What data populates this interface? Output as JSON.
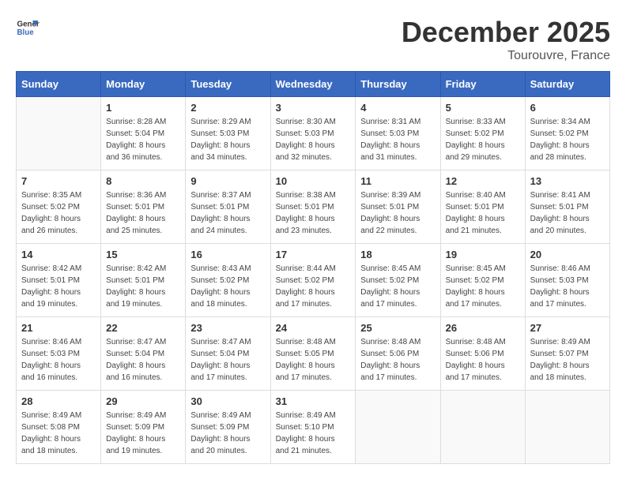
{
  "header": {
    "logo_line1": "General",
    "logo_line2": "Blue",
    "month": "December 2025",
    "location": "Tourouvre, France"
  },
  "days_of_week": [
    "Sunday",
    "Monday",
    "Tuesday",
    "Wednesday",
    "Thursday",
    "Friday",
    "Saturday"
  ],
  "weeks": [
    [
      {
        "day": "",
        "info": ""
      },
      {
        "day": "1",
        "info": "Sunrise: 8:28 AM\nSunset: 5:04 PM\nDaylight: 8 hours\nand 36 minutes."
      },
      {
        "day": "2",
        "info": "Sunrise: 8:29 AM\nSunset: 5:03 PM\nDaylight: 8 hours\nand 34 minutes."
      },
      {
        "day": "3",
        "info": "Sunrise: 8:30 AM\nSunset: 5:03 PM\nDaylight: 8 hours\nand 32 minutes."
      },
      {
        "day": "4",
        "info": "Sunrise: 8:31 AM\nSunset: 5:03 PM\nDaylight: 8 hours\nand 31 minutes."
      },
      {
        "day": "5",
        "info": "Sunrise: 8:33 AM\nSunset: 5:02 PM\nDaylight: 8 hours\nand 29 minutes."
      },
      {
        "day": "6",
        "info": "Sunrise: 8:34 AM\nSunset: 5:02 PM\nDaylight: 8 hours\nand 28 minutes."
      }
    ],
    [
      {
        "day": "7",
        "info": "Sunrise: 8:35 AM\nSunset: 5:02 PM\nDaylight: 8 hours\nand 26 minutes."
      },
      {
        "day": "8",
        "info": "Sunrise: 8:36 AM\nSunset: 5:01 PM\nDaylight: 8 hours\nand 25 minutes."
      },
      {
        "day": "9",
        "info": "Sunrise: 8:37 AM\nSunset: 5:01 PM\nDaylight: 8 hours\nand 24 minutes."
      },
      {
        "day": "10",
        "info": "Sunrise: 8:38 AM\nSunset: 5:01 PM\nDaylight: 8 hours\nand 23 minutes."
      },
      {
        "day": "11",
        "info": "Sunrise: 8:39 AM\nSunset: 5:01 PM\nDaylight: 8 hours\nand 22 minutes."
      },
      {
        "day": "12",
        "info": "Sunrise: 8:40 AM\nSunset: 5:01 PM\nDaylight: 8 hours\nand 21 minutes."
      },
      {
        "day": "13",
        "info": "Sunrise: 8:41 AM\nSunset: 5:01 PM\nDaylight: 8 hours\nand 20 minutes."
      }
    ],
    [
      {
        "day": "14",
        "info": "Sunrise: 8:42 AM\nSunset: 5:01 PM\nDaylight: 8 hours\nand 19 minutes."
      },
      {
        "day": "15",
        "info": "Sunrise: 8:42 AM\nSunset: 5:01 PM\nDaylight: 8 hours\nand 19 minutes."
      },
      {
        "day": "16",
        "info": "Sunrise: 8:43 AM\nSunset: 5:02 PM\nDaylight: 8 hours\nand 18 minutes."
      },
      {
        "day": "17",
        "info": "Sunrise: 8:44 AM\nSunset: 5:02 PM\nDaylight: 8 hours\nand 17 minutes."
      },
      {
        "day": "18",
        "info": "Sunrise: 8:45 AM\nSunset: 5:02 PM\nDaylight: 8 hours\nand 17 minutes."
      },
      {
        "day": "19",
        "info": "Sunrise: 8:45 AM\nSunset: 5:02 PM\nDaylight: 8 hours\nand 17 minutes."
      },
      {
        "day": "20",
        "info": "Sunrise: 8:46 AM\nSunset: 5:03 PM\nDaylight: 8 hours\nand 17 minutes."
      }
    ],
    [
      {
        "day": "21",
        "info": "Sunrise: 8:46 AM\nSunset: 5:03 PM\nDaylight: 8 hours\nand 16 minutes."
      },
      {
        "day": "22",
        "info": "Sunrise: 8:47 AM\nSunset: 5:04 PM\nDaylight: 8 hours\nand 16 minutes."
      },
      {
        "day": "23",
        "info": "Sunrise: 8:47 AM\nSunset: 5:04 PM\nDaylight: 8 hours\nand 17 minutes."
      },
      {
        "day": "24",
        "info": "Sunrise: 8:48 AM\nSunset: 5:05 PM\nDaylight: 8 hours\nand 17 minutes."
      },
      {
        "day": "25",
        "info": "Sunrise: 8:48 AM\nSunset: 5:06 PM\nDaylight: 8 hours\nand 17 minutes."
      },
      {
        "day": "26",
        "info": "Sunrise: 8:48 AM\nSunset: 5:06 PM\nDaylight: 8 hours\nand 17 minutes."
      },
      {
        "day": "27",
        "info": "Sunrise: 8:49 AM\nSunset: 5:07 PM\nDaylight: 8 hours\nand 18 minutes."
      }
    ],
    [
      {
        "day": "28",
        "info": "Sunrise: 8:49 AM\nSunset: 5:08 PM\nDaylight: 8 hours\nand 18 minutes."
      },
      {
        "day": "29",
        "info": "Sunrise: 8:49 AM\nSunset: 5:09 PM\nDaylight: 8 hours\nand 19 minutes."
      },
      {
        "day": "30",
        "info": "Sunrise: 8:49 AM\nSunset: 5:09 PM\nDaylight: 8 hours\nand 20 minutes."
      },
      {
        "day": "31",
        "info": "Sunrise: 8:49 AM\nSunset: 5:10 PM\nDaylight: 8 hours\nand 21 minutes."
      },
      {
        "day": "",
        "info": ""
      },
      {
        "day": "",
        "info": ""
      },
      {
        "day": "",
        "info": ""
      }
    ]
  ]
}
